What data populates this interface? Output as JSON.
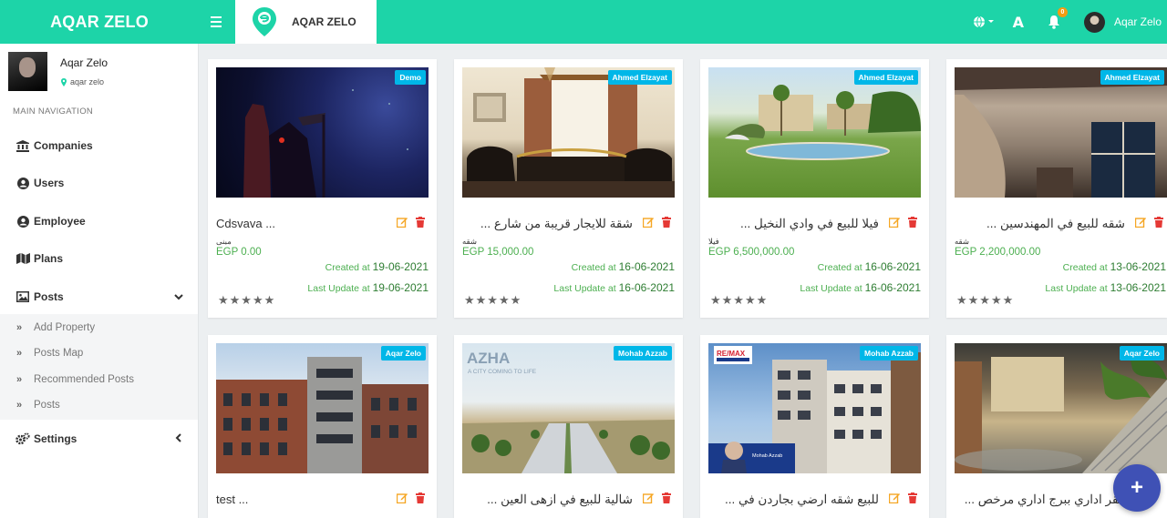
{
  "brand": "AQAR ZELO",
  "logo_text": "AQAR ZELO",
  "header": {
    "user_name": "Aqar Zelo",
    "font_label": "A",
    "notification_count": "0"
  },
  "sidebar": {
    "user_name": "Aqar Zelo",
    "user_sub": "aqar zelo",
    "nav_header": "MAIN NAVIGATION",
    "items": [
      {
        "label": "Companies",
        "icon": "bank-icon"
      },
      {
        "label": "Users",
        "icon": "user-circle-icon"
      },
      {
        "label": "Employee",
        "icon": "user-circle-icon"
      },
      {
        "label": "Plans",
        "icon": "map-icon"
      },
      {
        "label": "Posts",
        "icon": "image-icon"
      },
      {
        "label": "Settings",
        "icon": "cogs-icon"
      }
    ],
    "posts_submenu": [
      "Add Property",
      "Posts Map",
      "Recommended Posts",
      "Posts"
    ]
  },
  "cards": [
    {
      "badge": "Demo",
      "title": "Cdsvava ...",
      "rtl": false,
      "category": "مبنى",
      "price": "EGP 0.00",
      "created_label": "Created at",
      "created": "19-06-2021",
      "updated_label": "Last Update at",
      "updated": "19-06-2021",
      "stars": "★★★★★"
    },
    {
      "badge": "Ahmed Elzayat",
      "title": "شقة للايجار قريبة من شارع ...",
      "rtl": true,
      "category": "شقه",
      "price": "EGP 15,000.00",
      "created_label": "Created at",
      "created": "16-06-2021",
      "updated_label": "Last Update at",
      "updated": "16-06-2021",
      "stars": "★★★★★"
    },
    {
      "badge": "Ahmed Elzayat",
      "title": "فيلا للبيع في وادي النخيل ...",
      "rtl": true,
      "category": "فيلا",
      "price": "EGP 6,500,000.00",
      "created_label": "Created at",
      "created": "16-06-2021",
      "updated_label": "Last Update at",
      "updated": "16-06-2021",
      "stars": "★★★★★"
    },
    {
      "badge": "Ahmed Elzayat",
      "title": "شقه للبيع في المهندسين ...",
      "rtl": true,
      "category": "شقه",
      "price": "EGP 2,200,000.00",
      "created_label": "Created at",
      "created": "13-06-2021",
      "updated_label": "Last Update at",
      "updated": "13-06-2021",
      "stars": "★★★★★"
    },
    {
      "badge": "Aqar Zelo",
      "title": "test ...",
      "rtl": false,
      "category": "",
      "price": "",
      "created_label": "",
      "created": "",
      "updated_label": "",
      "updated": "",
      "stars": ""
    },
    {
      "badge": "Mohab Azzab",
      "title": "شالية للبيع في ازهى العين ...",
      "rtl": true,
      "category": "",
      "price": "",
      "created_label": "",
      "created": "",
      "updated_label": "",
      "updated": "",
      "stars": ""
    },
    {
      "badge": "Mohab Azzab",
      "title": "للبيع شقه ارضي بجاردن في ...",
      "rtl": true,
      "category": "",
      "price": "",
      "created_label": "",
      "created": "",
      "updated_label": "",
      "updated": "",
      "stars": ""
    },
    {
      "badge": "Aqar Zelo",
      "title": "مقر اداري ببرج اداري مرخص ...",
      "rtl": true,
      "category": "",
      "price": "",
      "created_label": "",
      "created": "",
      "updated_label": "",
      "updated": "",
      "stars": ""
    }
  ],
  "image_text": {
    "azha_title": "AZHA",
    "azha_sub": "A CITY COMING TO LIFE",
    "remax": "RE/MAX",
    "agent_name": "Mohab Azzab"
  },
  "fab_label": "+",
  "colors": {
    "topbar": "#1dd4a8",
    "badge": "#00b7e8",
    "price": "#4caf50",
    "edit": "#f5a623",
    "delete": "#e53935",
    "fab": "#3f51b5"
  }
}
